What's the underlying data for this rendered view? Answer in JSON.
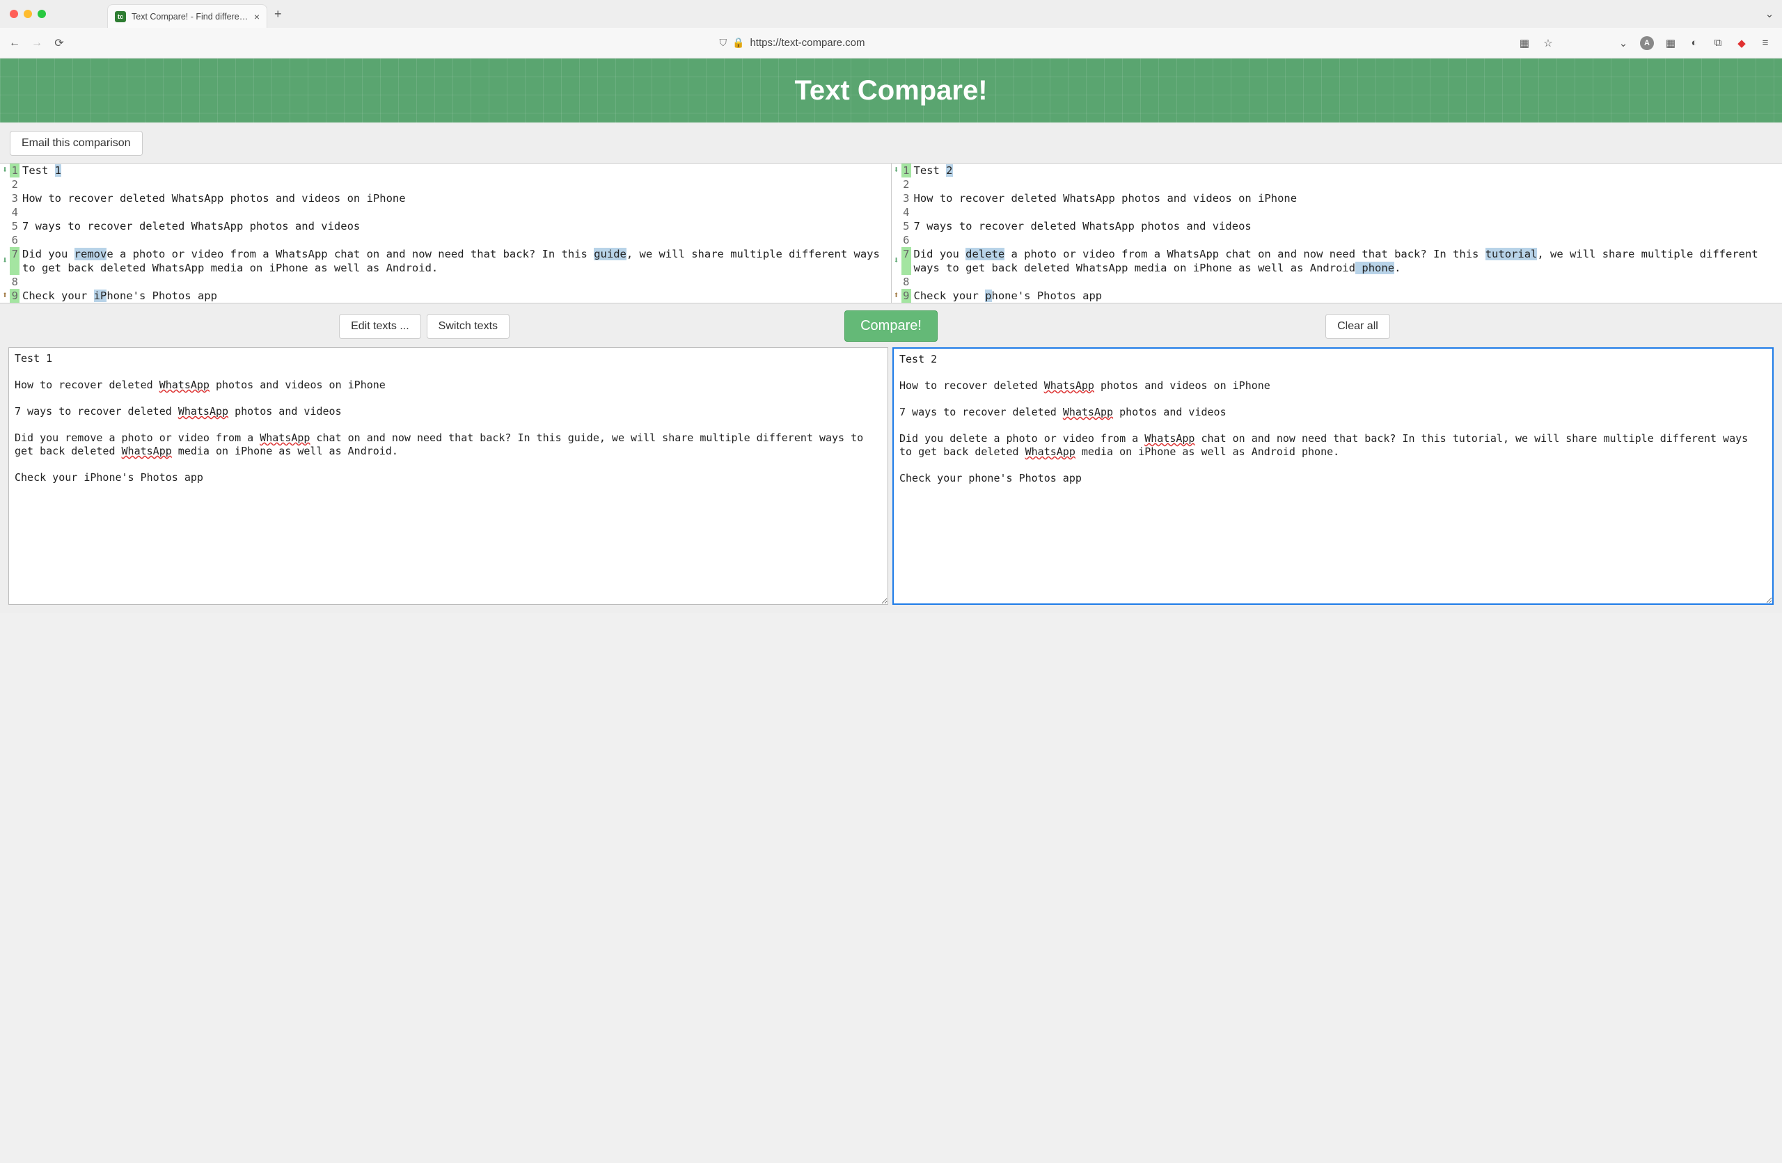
{
  "browser": {
    "tab_title": "Text Compare! - Find differenc",
    "url": "https://text-compare.com"
  },
  "header": {
    "title": "Text Compare!"
  },
  "buttons": {
    "email": "Email this comparison",
    "edit_texts": "Edit texts ...",
    "switch_texts": "Switch texts",
    "compare": "Compare!",
    "clear_all": "Clear all"
  },
  "diff": {
    "left": [
      {
        "n": 1,
        "diff": true,
        "arrow": "down",
        "parts": [
          {
            "t": "Test "
          },
          {
            "t": "1",
            "h": true
          }
        ]
      },
      {
        "n": 2,
        "diff": false,
        "arrow": "",
        "parts": [
          {
            "t": ""
          }
        ]
      },
      {
        "n": 3,
        "diff": false,
        "arrow": "",
        "parts": [
          {
            "t": "How to recover deleted WhatsApp photos and videos on iPhone"
          }
        ]
      },
      {
        "n": 4,
        "diff": false,
        "arrow": "",
        "parts": [
          {
            "t": ""
          }
        ]
      },
      {
        "n": 5,
        "diff": false,
        "arrow": "",
        "parts": [
          {
            "t": "7 ways to recover deleted WhatsApp photos and videos"
          }
        ]
      },
      {
        "n": 6,
        "diff": false,
        "arrow": "",
        "parts": [
          {
            "t": ""
          }
        ]
      },
      {
        "n": 7,
        "diff": true,
        "arrow": "down",
        "parts": [
          {
            "t": "Did you "
          },
          {
            "t": "remov",
            "h": true
          },
          {
            "t": "e a photo or video from a WhatsApp chat on and now need that back? In this "
          },
          {
            "t": "guide",
            "h": true
          },
          {
            "t": ", we will share multiple different ways to get back deleted WhatsApp media on iPhone as well as Android."
          }
        ]
      },
      {
        "n": 8,
        "diff": false,
        "arrow": "",
        "parts": [
          {
            "t": ""
          }
        ]
      },
      {
        "n": 9,
        "diff": true,
        "arrow": "up",
        "parts": [
          {
            "t": "Check your "
          },
          {
            "t": "iP",
            "h": true
          },
          {
            "t": "hone's Photos app"
          }
        ]
      }
    ],
    "right": [
      {
        "n": 1,
        "diff": true,
        "arrow": "down",
        "parts": [
          {
            "t": "Test "
          },
          {
            "t": "2",
            "h": true
          }
        ]
      },
      {
        "n": 2,
        "diff": false,
        "arrow": "",
        "parts": [
          {
            "t": ""
          }
        ]
      },
      {
        "n": 3,
        "diff": false,
        "arrow": "",
        "parts": [
          {
            "t": "How to recover deleted WhatsApp photos and videos on iPhone"
          }
        ]
      },
      {
        "n": 4,
        "diff": false,
        "arrow": "",
        "parts": [
          {
            "t": ""
          }
        ]
      },
      {
        "n": 5,
        "diff": false,
        "arrow": "",
        "parts": [
          {
            "t": "7 ways to recover deleted WhatsApp photos and videos"
          }
        ]
      },
      {
        "n": 6,
        "diff": false,
        "arrow": "",
        "parts": [
          {
            "t": ""
          }
        ]
      },
      {
        "n": 7,
        "diff": true,
        "arrow": "down",
        "parts": [
          {
            "t": "Did you "
          },
          {
            "t": "delete",
            "h": true
          },
          {
            "t": " a photo or video from a WhatsApp chat on and now need that back? In this "
          },
          {
            "t": "tutorial",
            "h": true
          },
          {
            "t": ", we will share multiple different ways to get back deleted WhatsApp media on iPhone as well as Android"
          },
          {
            "t": " phone",
            "h": true
          },
          {
            "t": "."
          }
        ]
      },
      {
        "n": 8,
        "diff": false,
        "arrow": "",
        "parts": [
          {
            "t": ""
          }
        ]
      },
      {
        "n": 9,
        "diff": true,
        "arrow": "up",
        "parts": [
          {
            "t": "Check your "
          },
          {
            "t": "p",
            "h": true
          },
          {
            "t": "hone's Photos app"
          }
        ]
      }
    ]
  },
  "textareas": {
    "left": "Test 1\n\nHow to recover deleted WhatsApp photos and videos on iPhone\n\n7 ways to recover deleted WhatsApp photos and videos\n\nDid you remove a photo or video from a WhatsApp chat on and now need that back? In this guide, we will share multiple different ways to get back deleted WhatsApp media on iPhone as well as Android.\n\nCheck your iPhone's Photos app",
    "right": "Test 2\n\nHow to recover deleted WhatsApp photos and videos on iPhone\n\n7 ways to recover deleted WhatsApp photos and videos\n\nDid you delete a photo or video from a WhatsApp chat on and now need that back? In this tutorial, we will share multiple different ways to get back deleted WhatsApp media on iPhone as well as Android phone.\n\nCheck your phone's Photos app",
    "spellcheck_words": [
      "WhatsApp"
    ]
  }
}
